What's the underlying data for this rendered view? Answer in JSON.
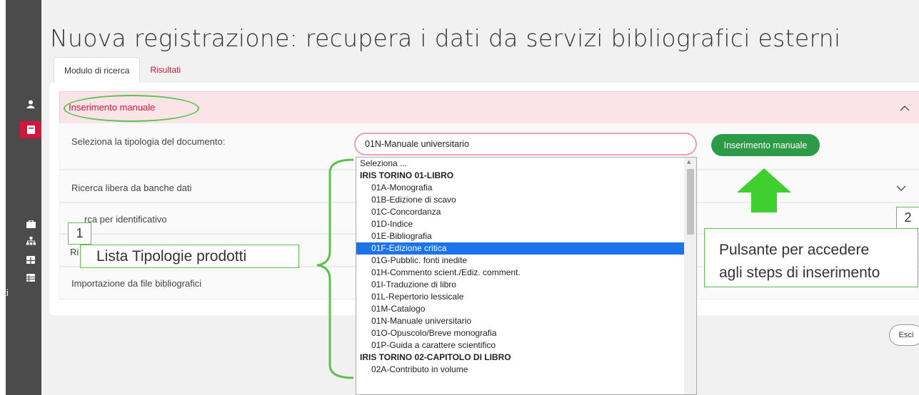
{
  "page": {
    "title": "Nuova registrazione: recupera i dati da servizi bibliografici esterni"
  },
  "tabs": [
    {
      "label": "Modulo di ricerca",
      "active": true
    },
    {
      "label": "Risultati",
      "active": false
    }
  ],
  "sidebar": {
    "icons": [
      "user-icon",
      "book-icon",
      "briefcase-icon",
      "sitemap-icon",
      "grid-icon",
      "list-icon"
    ],
    "cut_text": "ti",
    "accent": "#d2163d",
    "bg": "#4b4b4b"
  },
  "sections": {
    "manual": {
      "header": "Inserimento manuale",
      "row_label": "Seleziona la tipologia del documento:",
      "selected_value": "01N-Manuale universitario",
      "button": "Inserimento manuale"
    },
    "free_search": "Ricerca libera da banche dati",
    "id_search": "rca per identificativo",
    "row_fragment_a": "Ri",
    "import_fragment": "Importazione da file bibliografici"
  },
  "dropdown": {
    "items": [
      {
        "label": "Seleziona ...",
        "kind": "plain"
      },
      {
        "label": "IRIS TORINO 01-LIBRO",
        "kind": "group"
      },
      {
        "label": "01A-Monografia",
        "kind": "option"
      },
      {
        "label": "01B-Edizione di scavo",
        "kind": "option"
      },
      {
        "label": "01C-Concordanza",
        "kind": "option"
      },
      {
        "label": "01D-Indice",
        "kind": "option"
      },
      {
        "label": "01E-Bibliografia",
        "kind": "option"
      },
      {
        "label": "01F-Edizione critica",
        "kind": "option",
        "highlighted": true
      },
      {
        "label": "01G-Pubblic. fonti inedite",
        "kind": "option"
      },
      {
        "label": "01H-Commento scient./Ediz. comment.",
        "kind": "option"
      },
      {
        "label": "01I-Traduzione di libro",
        "kind": "option"
      },
      {
        "label": "01L-Repertorio lessicale",
        "kind": "option"
      },
      {
        "label": "01M-Catalogo",
        "kind": "option"
      },
      {
        "label": "01N-Manuale universitario",
        "kind": "option"
      },
      {
        "label": "01O-Opuscolo/Breve monografia",
        "kind": "option"
      },
      {
        "label": "01P-Guida a carattere scientifico",
        "kind": "option"
      },
      {
        "label": "IRIS TORINO 02-CAPITOLO DI LIBRO",
        "kind": "group"
      },
      {
        "label": "02A-Contributo in volume",
        "kind": "option"
      }
    ]
  },
  "exit_button": "Esci",
  "annotations": {
    "one_number": "1",
    "one_label": "Lista Tipologie prodotti",
    "two_number": "2",
    "two_label_line1": "Pulsante per accedere",
    "two_label_line2": "agli steps di inserimento",
    "color": "#5cc24b",
    "arrow_color": "#3fcf2e"
  },
  "colors": {
    "accent_red": "#d2163d",
    "button_green": "#2d9a47",
    "selection_blue": "#1e73e8",
    "header_pink": "#fbe4e7"
  }
}
